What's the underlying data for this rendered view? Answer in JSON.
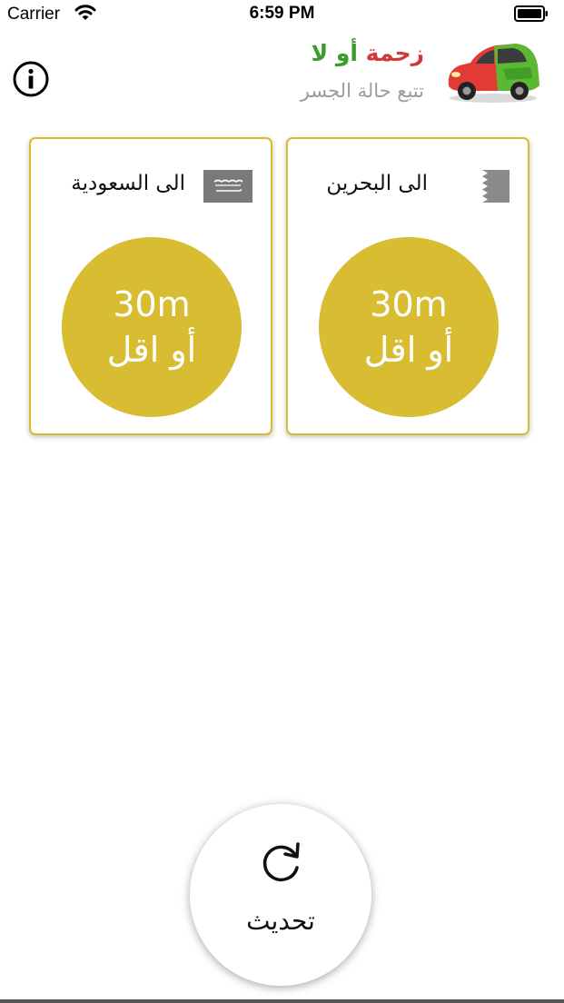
{
  "status_bar": {
    "carrier": "Carrier",
    "time": "6:59 PM",
    "icons": [
      "wifi-icon",
      "battery-icon"
    ]
  },
  "header": {
    "title_part1": "زحمة",
    "title_part2": "أو لا",
    "subtitle": "تتبع حالة الجسر",
    "info_icon": "info-icon",
    "logo_icon": "car-logo"
  },
  "cards": [
    {
      "label": "الى البحرين",
      "flag": "bahrain-flag-icon",
      "wait_time": "30m",
      "wait_suffix": "أو اقل"
    },
    {
      "label": "الى السعودية",
      "flag": "saudi-flag-icon",
      "wait_time": "30m",
      "wait_suffix": "أو اقل"
    }
  ],
  "refresh": {
    "label": "تحديث",
    "icon": "refresh-icon"
  },
  "colors": {
    "accent": "#d8bc32",
    "title_red": "#d0393a",
    "title_green": "#3a9c2a",
    "subtitle_gray": "#9b9b9b"
  }
}
